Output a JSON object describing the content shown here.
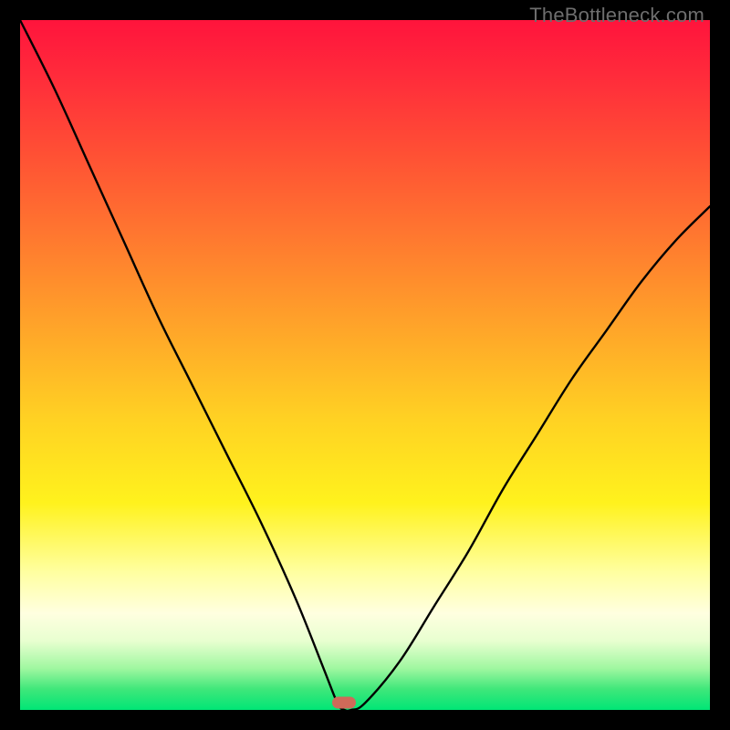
{
  "watermark": "TheBottleneck.com",
  "colors": {
    "frame": "#000000",
    "curve": "#000000",
    "marker": "#cf6a59",
    "gradient_top": "#ff143c",
    "gradient_bottom": "#00e676"
  },
  "chart_data": {
    "type": "line",
    "title": "",
    "xlabel": "",
    "ylabel": "",
    "xlim": [
      0,
      100
    ],
    "ylim": [
      0,
      100
    ],
    "grid": false,
    "minimum_marker": {
      "x": 47,
      "y": 0
    },
    "series": [
      {
        "name": "bottleneck-curve",
        "x": [
          0,
          5,
          10,
          15,
          20,
          25,
          30,
          35,
          40,
          44,
          46,
          47,
          48,
          50,
          55,
          60,
          65,
          70,
          75,
          80,
          85,
          90,
          95,
          100
        ],
        "y": [
          100,
          90,
          79,
          68,
          57,
          47,
          37,
          27,
          16,
          6,
          1,
          0,
          0,
          1,
          7,
          15,
          23,
          32,
          40,
          48,
          55,
          62,
          68,
          73
        ]
      }
    ]
  }
}
